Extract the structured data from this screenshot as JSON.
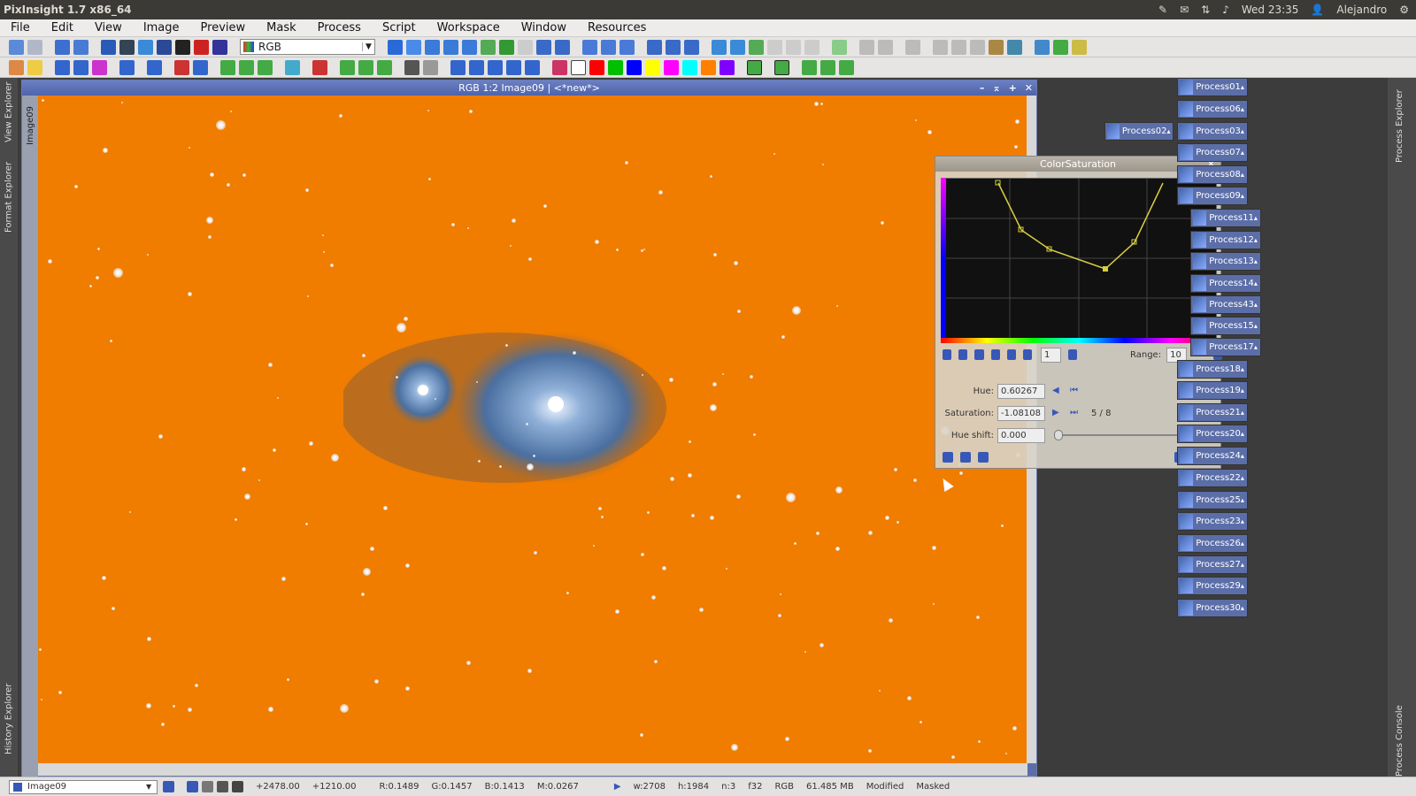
{
  "system": {
    "app_title": "PixInsight 1.7 x86_64",
    "clock": "Wed 23:35",
    "user": "Alejandro"
  },
  "menu": [
    "File",
    "Edit",
    "View",
    "Image",
    "Preview",
    "Mask",
    "Process",
    "Script",
    "Workspace",
    "Window",
    "Resources"
  ],
  "toolbar": {
    "channel_select": "RGB",
    "swatch_colors": [
      "#ff0000",
      "#00c000",
      "#0000ff",
      "#ffff00",
      "#ff00ff",
      "#00ffff",
      "#ff8000",
      "#8000ff"
    ]
  },
  "left_dock": {
    "tabs": [
      "View Explorer",
      "Format Explorer",
      "History Explorer"
    ]
  },
  "right_dock": {
    "tabs": [
      "Process Explorer",
      "Process Console"
    ]
  },
  "image_window": {
    "title": "RGB 1:2 Image09 | <*new*>",
    "side_tab": "Image09",
    "background_color": "#f07c00"
  },
  "color_saturation": {
    "title": "ColorSaturation",
    "page_value": "1",
    "range_label": "Range:",
    "range_value": "10",
    "hue_label": "Hue:",
    "hue_value": "0.60267",
    "saturation_label": "Saturation:",
    "saturation_value": "-1.08108",
    "hue_shift_label": "Hue shift:",
    "hue_shift_value": "0.000",
    "point_counter": "5 / 8"
  },
  "process_icons": [
    {
      "name": "Process01"
    },
    {
      "name": "Process06"
    },
    {
      "name": "Process03"
    },
    {
      "name": "Process02"
    },
    {
      "name": "Process07"
    },
    {
      "name": "Process08"
    },
    {
      "name": "Process09"
    },
    {
      "name": "Process11"
    },
    {
      "name": "Process12"
    },
    {
      "name": "Process13"
    },
    {
      "name": "Process14"
    },
    {
      "name": "Process43"
    },
    {
      "name": "Process15"
    },
    {
      "name": "Process17"
    },
    {
      "name": "Process18"
    },
    {
      "name": "Process19"
    },
    {
      "name": "Process21"
    },
    {
      "name": "Process20"
    },
    {
      "name": "Process24"
    },
    {
      "name": "Process22"
    },
    {
      "name": "Process25"
    },
    {
      "name": "Process23"
    },
    {
      "name": "Process26"
    },
    {
      "name": "Process27"
    },
    {
      "name": "Process29"
    },
    {
      "name": "Process30"
    }
  ],
  "status": {
    "view": "Image09",
    "x": "+2478.00",
    "y": "+1210.00",
    "r": "R:0.1489",
    "g": "G:0.1457",
    "b": "B:0.1413",
    "m": "M:0.0267",
    "w": "w:2708",
    "h": "h:1984",
    "n": "n:3",
    "fmt": "f32",
    "space": "RGB",
    "size": "61.485 MB",
    "state1": "Modified",
    "state2": "Masked"
  }
}
